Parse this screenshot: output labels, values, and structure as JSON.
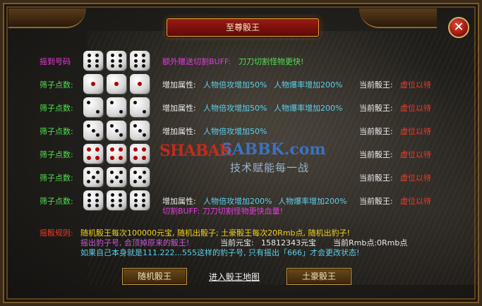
{
  "window": {
    "title": "至尊骰王"
  },
  "rows": [
    {
      "label": "摇到号码",
      "label_color": "#e43cde",
      "dice": [
        6,
        6,
        6
      ],
      "pip_style": "black",
      "extra_label": "额外赠送切割BUFF:",
      "extra_value": "刀刀切割怪物更快!"
    },
    {
      "label": "筛子点数:",
      "label_color": "#4ee24e",
      "dice": [
        1,
        1,
        1
      ],
      "pip_style": "red",
      "attr_label": "增加属性:",
      "attr1": "人物倍攻增加50%",
      "attr2": "人物爆率增加200%",
      "king_label": "当前骰王:",
      "king_value": "虚位以待"
    },
    {
      "label": "筛子点数:",
      "label_color": "#4ee24e",
      "dice": [
        2,
        2,
        2
      ],
      "pip_style": "black",
      "attr_label": "增加属性:",
      "attr1": "人物倍攻增加50%",
      "attr2": "人物爆率增加200%",
      "king_label": "当前骰王:",
      "king_value": "虚位以待"
    },
    {
      "label": "筛子点数:",
      "label_color": "#4ee24e",
      "dice": [
        3,
        3,
        3
      ],
      "pip_style": "black",
      "attr_label": "增加属性:",
      "attr1": "人物倍攻增加50%",
      "attr2": "",
      "king_label": "当前骰王:",
      "king_value": "虚位以待"
    },
    {
      "label": "筛子点数:",
      "label_color": "#4ee24e",
      "dice": [
        4,
        4,
        4
      ],
      "pip_style": "red",
      "attr_label": "增加属性:",
      "attr1": "",
      "attr2": "",
      "king_label": "当前骰王:",
      "king_value": "虚位以待"
    },
    {
      "label": "筛子点数:",
      "label_color": "#4ee24e",
      "dice": [
        5,
        5,
        5
      ],
      "pip_style": "black",
      "attr_label": "增加属性:",
      "attr1": "",
      "attr2": "",
      "king_label": "当前骰王:",
      "king_value": "虚位以待"
    },
    {
      "label": "筛子点数:",
      "label_color": "#4ee24e",
      "dice": [
        6,
        6,
        6
      ],
      "pip_style": "black",
      "attr_label": "增加属性:",
      "attr1": "人物倍攻增加200%",
      "attr2": "人物爆率增加200%",
      "king_label": "当前骰王:",
      "king_value": "虚位以待",
      "buff_line": "切割BUFF:  刀刀切割怪物更快血量!"
    }
  ],
  "rules": {
    "label": "摇骰规则:",
    "line1": "随机骰王每次100000元宝, 随机出骰子; 土豪骰王每次20Rmb点, 随机出豹子!",
    "line2": "摇出豹子号, 会顶掉原来的骰王!",
    "yuanbao_label": "当前元宝:",
    "yuanbao_value": "15812343元宝",
    "rmb_label": "当前Rmb点:",
    "rmb_value": "0Rmb点",
    "line3": "如果自己本身就是111.222...555这样的豹子号, 只有摇出「666」才会更改状态!"
  },
  "buttons": {
    "random": "随机骰王",
    "enter": "进入骰王地图",
    "tuhao": "土豪骰王"
  },
  "watermark": {
    "logo": "SHABAK",
    "site": "5ABBK.com",
    "slogan": "技术赋能每一战"
  },
  "colors": {
    "title_bg": "#9a1a12",
    "frame_border": "#7a5a2c",
    "green": "#4ee24e",
    "red": "#f03a2a",
    "yellow": "#f2d21c",
    "cyan": "#5ad2ee"
  }
}
